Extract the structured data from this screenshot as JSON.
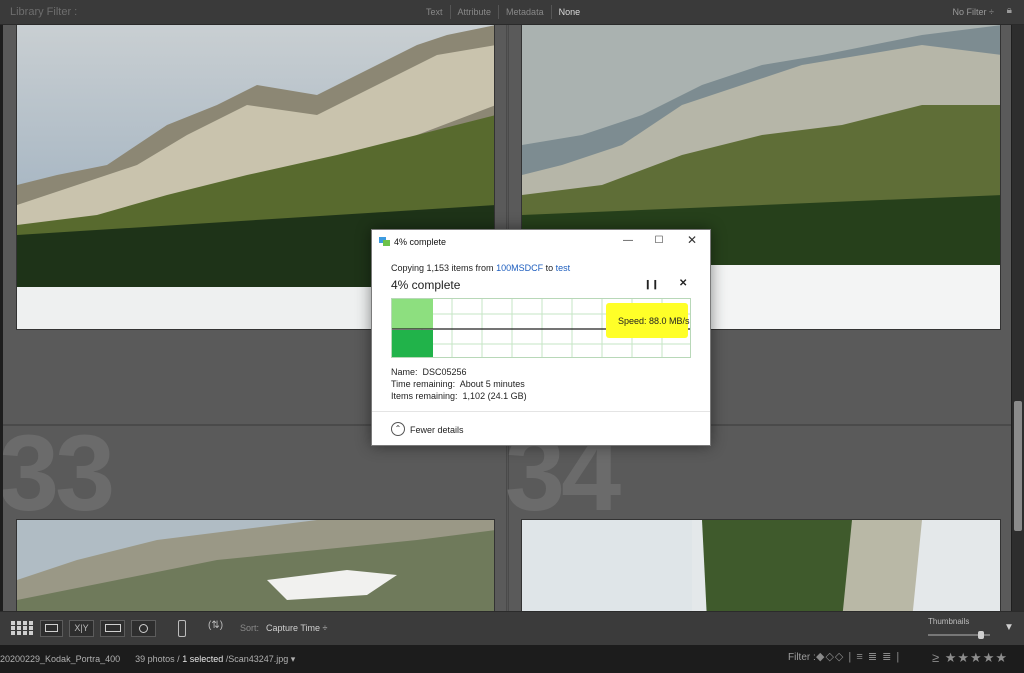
{
  "filter_bar": {
    "title": "Library Filter :",
    "tabs": [
      {
        "label": "Text"
      },
      {
        "label": "Attribute"
      },
      {
        "label": "Metadata"
      },
      {
        "label": "None",
        "active": true
      }
    ],
    "filter_preset": "No Filter ÷"
  },
  "grid": {
    "cell_numbers": [
      "33",
      "34"
    ]
  },
  "toolbar": {
    "view_modes": [
      "grid-view",
      "loupe-view",
      "compare-view",
      "survey-view",
      "people-view"
    ],
    "compare_label": "X|Y",
    "sort_label": "Sort:",
    "sort_value": "Capture Time ÷",
    "thumbnails_label": "Thumbnails"
  },
  "status_bar": {
    "folder": "20200229_Kodak_Portra_400",
    "count": "39 photos /",
    "selected": "1 selected",
    "file": "/Scan43247.jpg ▾",
    "filter_label": "Filter :",
    "min_rating": "≥"
  },
  "dialog": {
    "title": "4% complete",
    "copy_prefix": "Copying 1,153 items from",
    "source": "100MSDCF",
    "to": "to",
    "destination": "test",
    "percent": "4% complete",
    "progress": 0.04,
    "speed": "Speed: 88.0 MB/s",
    "name_label": "Name:",
    "name_value": "DSC05256",
    "time_label": "Time remaining:",
    "time_value": "About 5 minutes",
    "items_label": "Items remaining:",
    "items_value": "1,102 (24.1 GB)",
    "fewer_details": "Fewer details",
    "colors": {
      "highlight": "#ffff28",
      "progress_fill": "#21b34a",
      "progress_light": "#8ddf7f",
      "link": "#1f5fbf"
    }
  }
}
